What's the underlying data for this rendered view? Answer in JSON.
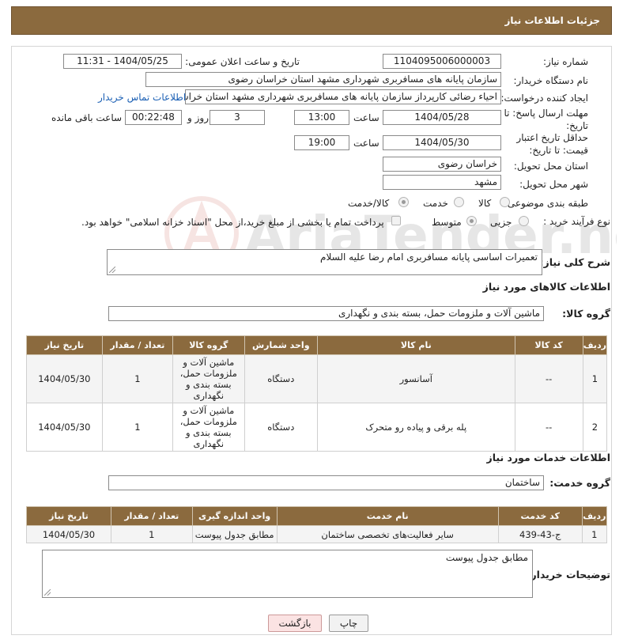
{
  "header": {
    "title": "جزئیات اطلاعات نیاز"
  },
  "form": {
    "need_number_label": "شماره نیاز:",
    "need_number": "1104095006000003",
    "announce_label": "تاریخ و ساعت اعلان عمومی:",
    "announce_value": "1404/05/25 - 11:31",
    "buyer_org_label": "نام دستگاه خریدار:",
    "buyer_org": "سازمان پایانه های مسافربری شهرداری مشهد استان خراسان رضوی",
    "creator_label": "ایجاد کننده درخواست:",
    "creator": "احیاء رضائی کارپرداز سازمان پایانه های مسافربری شهرداری مشهد استان خراسان رضوی",
    "contact_link": "اطلاعات تماس خریدار",
    "reply_deadline_label": "مهلت ارسال پاسخ: تا تاریخ:",
    "reply_date": "1404/05/28",
    "time_label": "ساعت",
    "reply_time": "13:00",
    "days_value": "3",
    "days_label": "روز و",
    "remaining_time": "00:22:48",
    "remaining_label": "ساعت باقی مانده",
    "price_deadline_label": "حداقل تاریخ اعتبار قیمت: تا تاریخ:",
    "price_date": "1404/05/30",
    "price_time": "19:00",
    "province_label": "استان محل تحویل:",
    "province": "خراسان رضوی",
    "city_label": "شهر محل تحویل:",
    "city": "مشهد",
    "category_label": "طبقه بندی موضوعی:",
    "category_options": [
      "کالا",
      "خدمت",
      "کالا/خدمت"
    ],
    "category_selected": "کالا/خدمت",
    "process_label": "نوع فرآیند خرید :",
    "process_options": [
      "جزیی",
      "متوسط"
    ],
    "process_selected": "متوسط",
    "payment_note": "پرداخت تمام یا بخشی از مبلغ خرید،از محل \"اسناد خزانه اسلامی\" خواهد بود.",
    "description_label": "شرح کلی نیاز:",
    "description": "تعمیرات اساسی پایانه مسافربری امام رضا علیه السلام"
  },
  "goods": {
    "section_title": "اطلاعات کالاهای مورد نیاز",
    "group_label": "گروه کالا:",
    "group_value": "ماشین آلات و ملزومات حمل، بسته بندی و نگهداری",
    "columns": [
      "ردیف",
      "کد کالا",
      "نام کالا",
      "واحد شمارش",
      "گروه کالا",
      "تعداد / مقدار",
      "تاریخ نیاز"
    ],
    "rows": [
      {
        "row": "1",
        "code": "--",
        "name": "آسانسور",
        "unit": "دستگاه",
        "group": "ماشین آلات و ملزومات حمل، بسته بندی و نگهداری",
        "qty": "1",
        "date": "1404/05/30"
      },
      {
        "row": "2",
        "code": "--",
        "name": "پله برقی و پیاده رو متحرک",
        "unit": "دستگاه",
        "group": "ماشین آلات و ملزومات حمل، بسته بندی و نگهداری",
        "qty": "1",
        "date": "1404/05/30"
      }
    ]
  },
  "services": {
    "section_title": "اطلاعات خدمات مورد نیاز",
    "group_label": "گروه خدمت:",
    "group_value": "ساختمان",
    "columns": [
      "ردیف",
      "کد خدمت",
      "نام خدمت",
      "واحد اندازه گیری",
      "تعداد / مقدار",
      "تاریخ نیاز"
    ],
    "rows": [
      {
        "row": "1",
        "code": "ج-43-439",
        "name": "سایر فعالیت‌های تخصصی ساختمان",
        "unit": "مطابق جدول پیوست",
        "qty": "1",
        "date": "1404/05/30"
      }
    ]
  },
  "buyer_notes": {
    "label": "توضیحات خریدار:",
    "value": "مطابق جدول پیوست"
  },
  "buttons": {
    "print": "چاپ",
    "back": "بازگشت"
  },
  "watermark": {
    "text": "AriaTender.neT"
  },
  "colors": {
    "header_bg": "#8b6a3e",
    "link": "#1a5fb4",
    "back_btn": "#fbe3e3"
  }
}
